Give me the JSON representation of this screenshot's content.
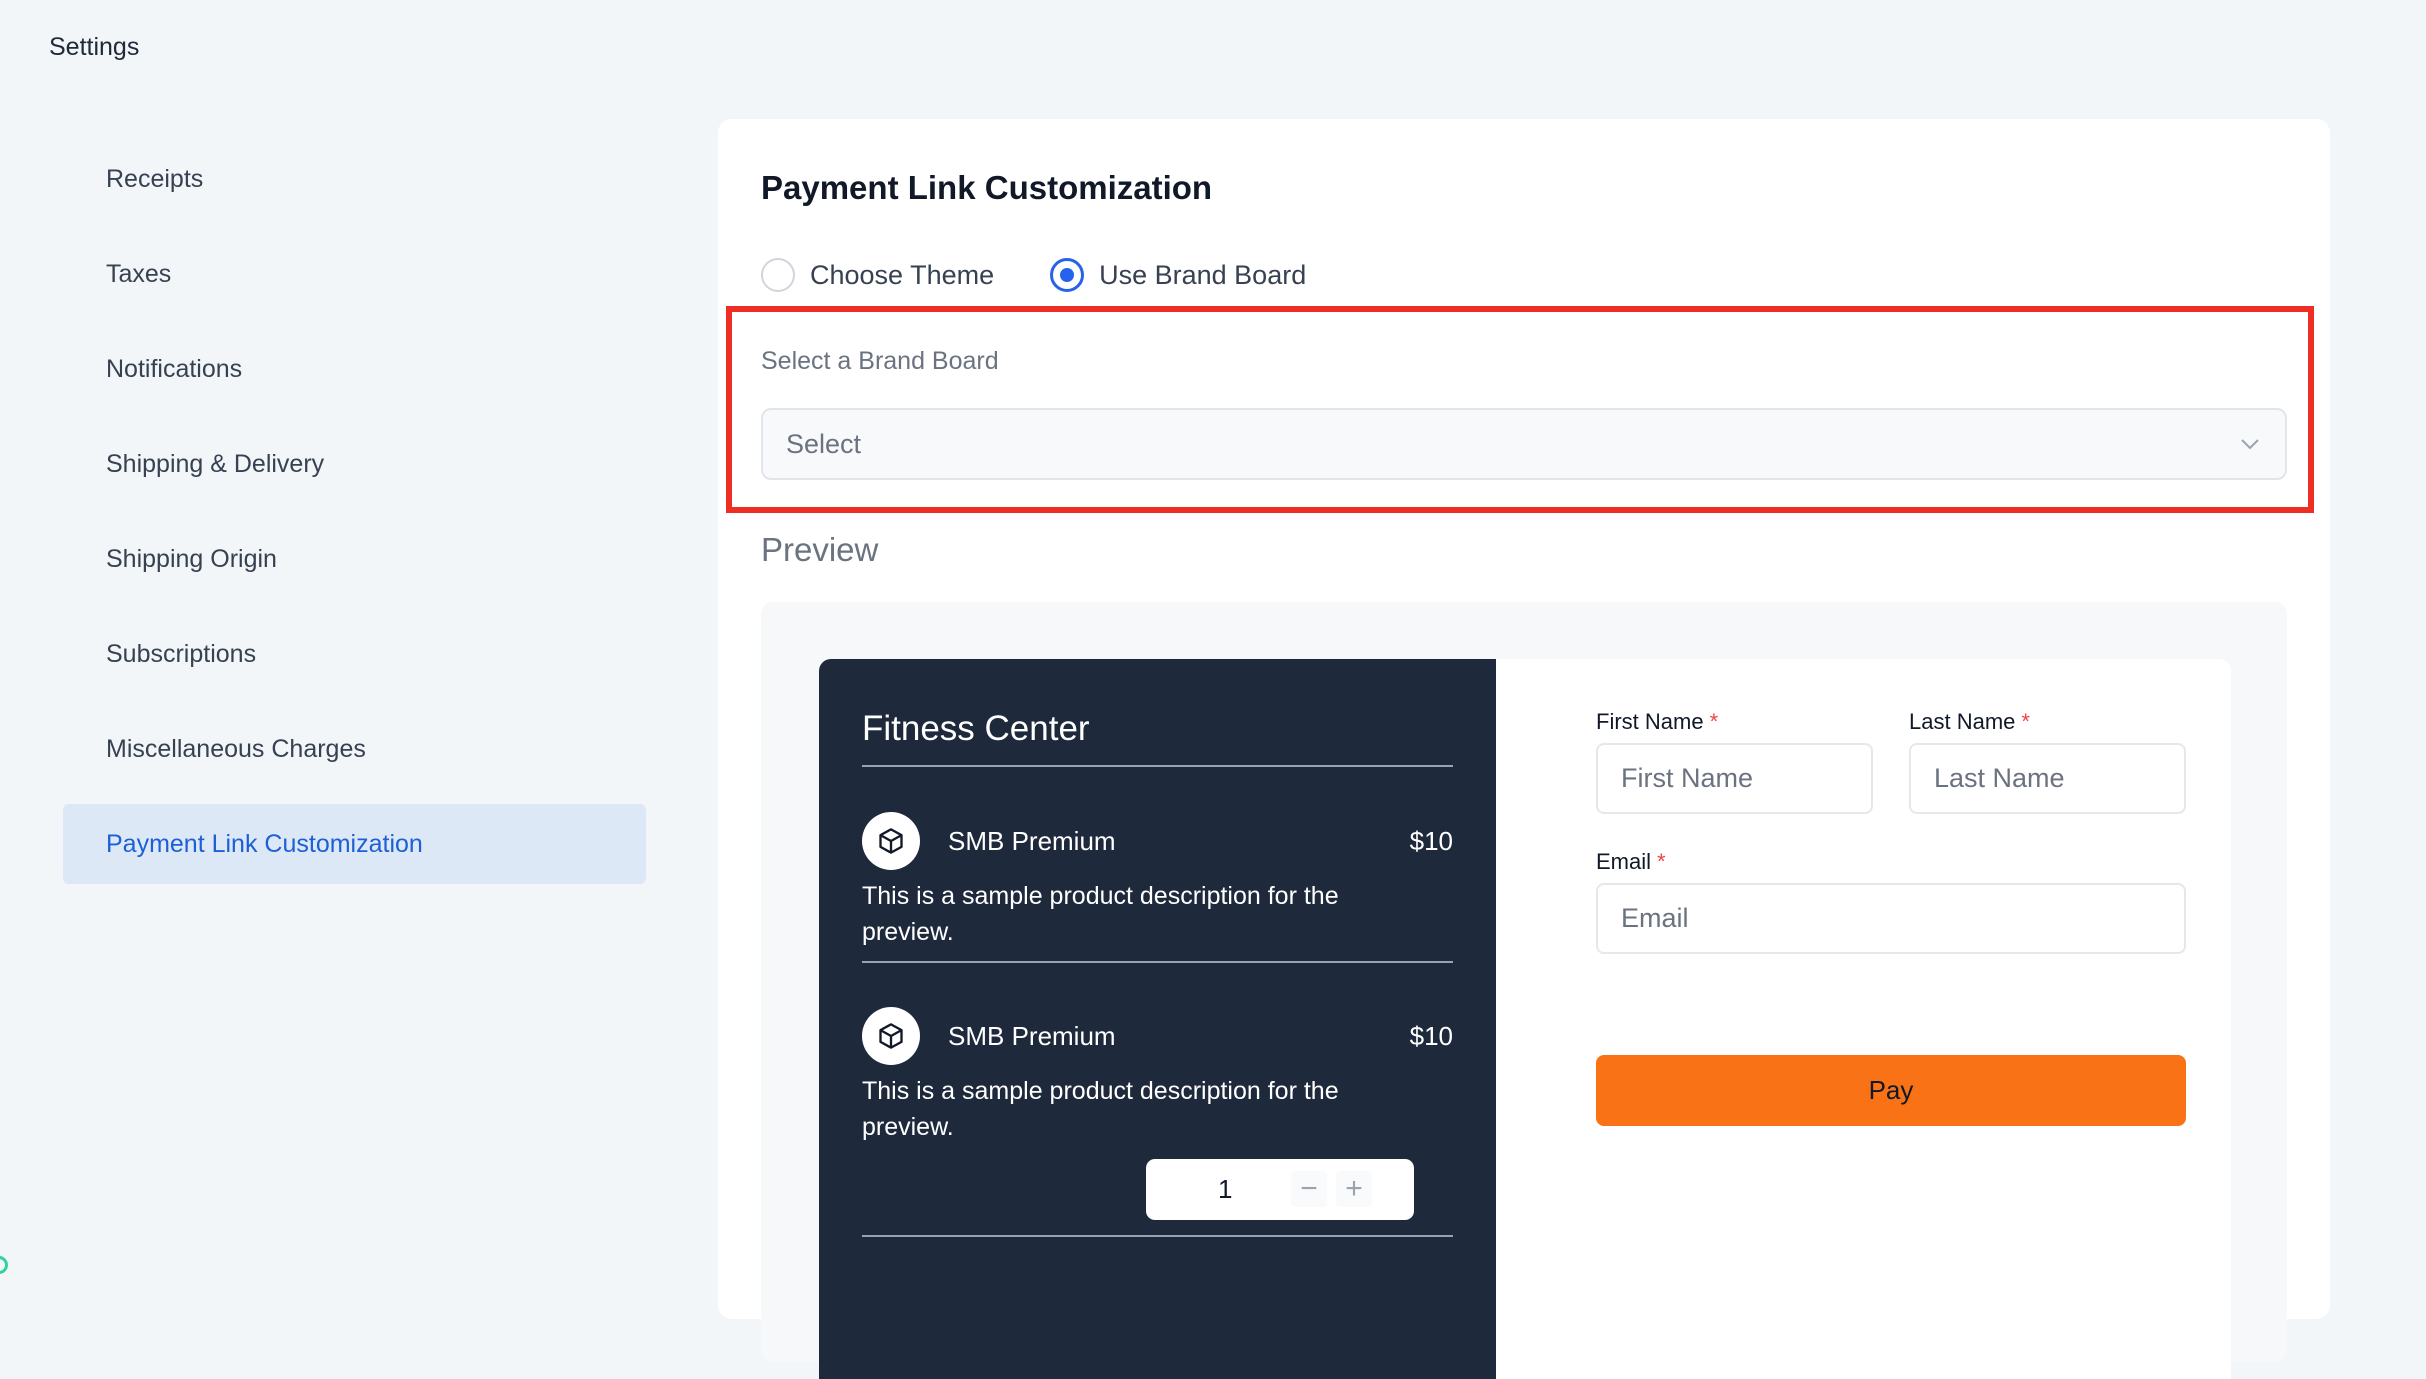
{
  "page_title": "Settings",
  "sidebar": {
    "items": [
      {
        "label": "Receipts"
      },
      {
        "label": "Taxes"
      },
      {
        "label": "Notifications"
      },
      {
        "label": "Shipping & Delivery"
      },
      {
        "label": "Shipping Origin"
      },
      {
        "label": "Subscriptions"
      },
      {
        "label": "Miscellaneous Charges"
      },
      {
        "label": "Payment Link Customization",
        "active": true
      }
    ]
  },
  "panel": {
    "title": "Payment Link Customization",
    "radio_options": [
      {
        "label": "Choose Theme",
        "checked": false
      },
      {
        "label": "Use Brand Board",
        "checked": true
      }
    ],
    "brand_board_label": "Select a Brand Board",
    "brand_board_select": "Select",
    "preview_label": "Preview"
  },
  "preview": {
    "store_name": "Fitness Center",
    "products": [
      {
        "name": "SMB Premium",
        "price": "$10",
        "description": "This is a sample product description for the preview.",
        "icon": "box-icon"
      },
      {
        "name": "SMB Premium",
        "price": "$10",
        "description": "This is a sample product description for the preview.",
        "icon": "box-icon"
      }
    ],
    "quantity": "1",
    "form": {
      "first_name_label": "First Name",
      "first_name_placeholder": "First Name",
      "last_name_label": "Last Name",
      "last_name_placeholder": "Last Name",
      "email_label": "Email",
      "email_placeholder": "Email",
      "required_mark": "*",
      "pay_label": "Pay"
    }
  },
  "colors": {
    "accent": "#2563eb",
    "pay_button": "#f97316",
    "highlight": "#ee2d24",
    "preview_dark": "#1e293b"
  }
}
